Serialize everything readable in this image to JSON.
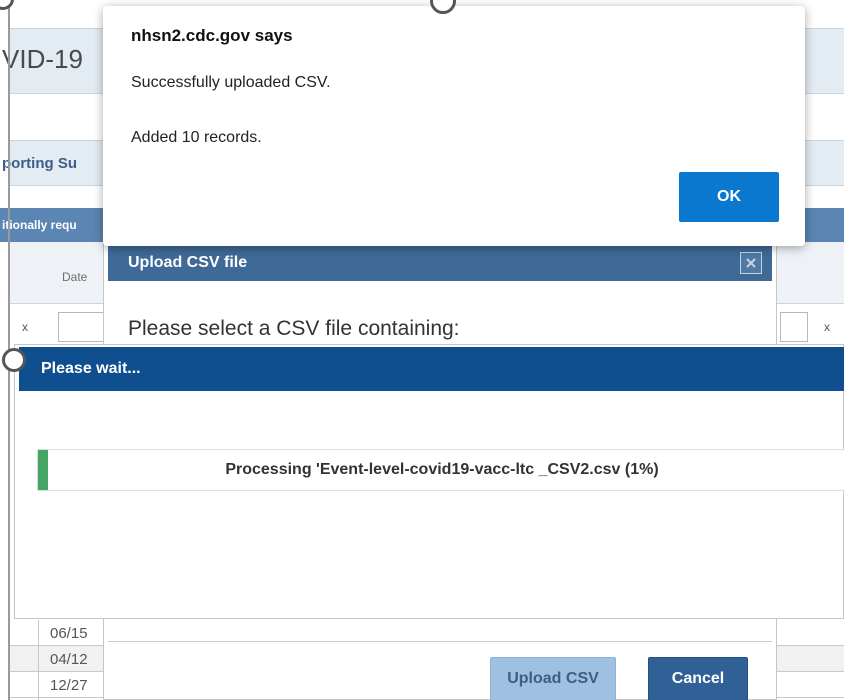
{
  "background": {
    "page_title": "VID-19",
    "section_title": "porting Su",
    "required_text": "itionally requ",
    "date_header": "Date",
    "left_marker": "x",
    "right_marker": "x",
    "date_rows": [
      "06/15",
      "04/12",
      "12/27"
    ]
  },
  "alert": {
    "origin": "nhsn2.cdc.gov says",
    "message_line1": "Successfully uploaded CSV.",
    "message_line2": "Added 10 records.",
    "ok_label": "OK"
  },
  "upload_modal": {
    "title": "Upload CSV file",
    "body_text": "Please select a CSV file containing:",
    "upload_button": "Upload CSV",
    "cancel_button": "Cancel",
    "close_icon": "close-icon"
  },
  "wait_dialog": {
    "title": "Please wait...",
    "progress_text": "Processing 'Event-level-covid19-vacc-ltc  _CSV2.csv (1%)",
    "progress_fraction": 0.01
  },
  "colors": {
    "alert_ok": "#0b78d0",
    "wait_header": "#0f4f8f",
    "upload_header": "#3f6a98",
    "progress_fill": "#44a564",
    "cancel_button": "#2f6196",
    "upload_button": "#9fc0e0"
  }
}
